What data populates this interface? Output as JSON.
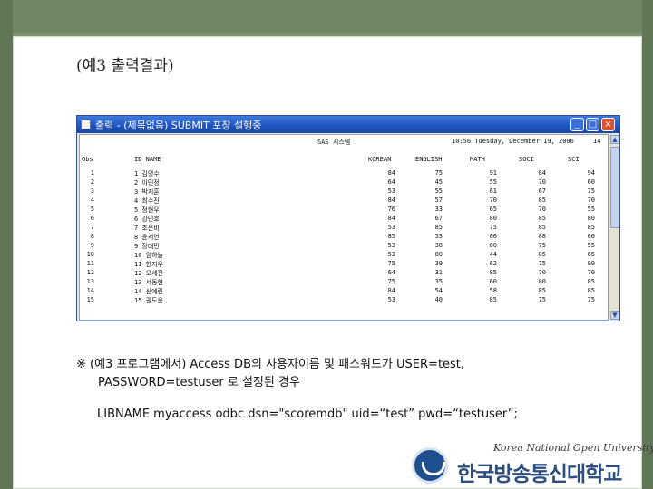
{
  "slide": {
    "title": "(예3 출력결과)",
    "caption_line1": "※ (예3 프로그램에서) Access DB의 사용자이름 및 패스워드가 USER=test,",
    "caption_line2": "PASSWORD=testuser 로 설정된 경우",
    "code_line": "LIBNAME myaccess odbc dsn=\"scoremdb\" uid=“test” pwd=“testuser”;"
  },
  "window": {
    "title": "출력 - (제목없음) SUBMIT 포장 설행중",
    "system_label": "SAS 시스템",
    "run_datetime": "10:56 Tuesday, December 19, 2006",
    "page_number": "14",
    "columns": [
      "Obs",
      "ID NAME",
      "KOREAN",
      "ENGLISH",
      "MATH",
      "SOCI",
      "SCI"
    ],
    "rows": [
      {
        "obs": "1",
        "id_name": "1 김영수",
        "korean": "84",
        "english": "75",
        "math": "91",
        "soci": "84",
        "sci": "94"
      },
      {
        "obs": "2",
        "id_name": "2 이민정",
        "korean": "64",
        "english": "45",
        "math": "55",
        "soci": "70",
        "sci": "60"
      },
      {
        "obs": "3",
        "id_name": "3 박지훈",
        "korean": "53",
        "english": "55",
        "math": "61",
        "soci": "67",
        "sci": "75"
      },
      {
        "obs": "4",
        "id_name": "4 최수진",
        "korean": "84",
        "english": "57",
        "math": "70",
        "soci": "85",
        "sci": "70"
      },
      {
        "obs": "5",
        "id_name": "5 정현우",
        "korean": "76",
        "english": "33",
        "math": "65",
        "soci": "70",
        "sci": "55"
      },
      {
        "obs": "6",
        "id_name": "6 강민호",
        "korean": "84",
        "english": "67",
        "math": "80",
        "soci": "85",
        "sci": "80"
      },
      {
        "obs": "7",
        "id_name": "7 조은비",
        "korean": "53",
        "english": "85",
        "math": "75",
        "soci": "85",
        "sci": "85"
      },
      {
        "obs": "8",
        "id_name": "8 윤서연",
        "korean": "85",
        "english": "53",
        "math": "60",
        "soci": "88",
        "sci": "60"
      },
      {
        "obs": "9",
        "id_name": "9 장태민",
        "korean": "53",
        "english": "38",
        "math": "80",
        "soci": "75",
        "sci": "55"
      },
      {
        "obs": "10",
        "id_name": "10 임하늘",
        "korean": "53",
        "english": "80",
        "math": "44",
        "soci": "85",
        "sci": "65"
      },
      {
        "obs": "11",
        "id_name": "11 한지우",
        "korean": "75",
        "english": "39",
        "math": "62",
        "soci": "75",
        "sci": "80"
      },
      {
        "obs": "12",
        "id_name": "12 오세진",
        "korean": "64",
        "english": "31",
        "math": "85",
        "soci": "70",
        "sci": "70"
      },
      {
        "obs": "13",
        "id_name": "13 서동현",
        "korean": "75",
        "english": "35",
        "math": "60",
        "soci": "80",
        "sci": "85"
      },
      {
        "obs": "14",
        "id_name": "14 신예린",
        "korean": "84",
        "english": "54",
        "math": "58",
        "soci": "85",
        "sci": "85"
      },
      {
        "obs": "15",
        "id_name": "15 권도윤",
        "korean": "53",
        "english": "40",
        "math": "85",
        "soci": "75",
        "sci": "75"
      }
    ]
  },
  "logo": {
    "english_name": "Korea National Open University",
    "korean_name": "한국방송통신대학교"
  }
}
